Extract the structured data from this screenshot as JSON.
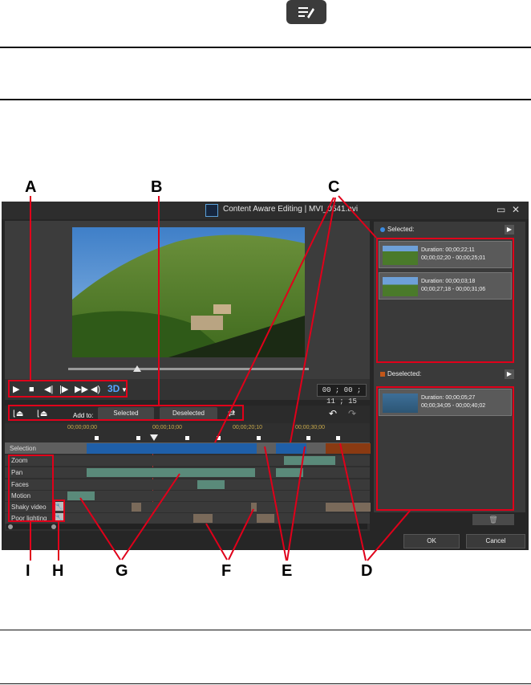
{
  "window": {
    "title": "Content Aware Editing",
    "separator": "|",
    "filename": "MVI_0541.avi",
    "restore_glyph": "▭",
    "close_glyph": "✕"
  },
  "callouts": [
    "A",
    "B",
    "C",
    "D",
    "E",
    "F",
    "G",
    "H",
    "I"
  ],
  "player": {
    "timecode": "00 ; 00 ; 11 ; 15",
    "mode_3d": "3D",
    "buttons": [
      "play-icon",
      "stop-icon",
      "prev-frame-icon",
      "next-frame-icon",
      "fast-forward-icon",
      "volume-icon"
    ]
  },
  "toolbar": {
    "add_to_label": "Add to:",
    "selected_button": "Selected",
    "deselected_button": "Deselected"
  },
  "ruler": [
    "00;00;00;00",
    "00;00;10;00",
    "00;00;20;10",
    "00;00;30;00"
  ],
  "rows": {
    "selection": "Selection",
    "labels": [
      "Zoom",
      "Pan",
      "Faces",
      "Motion",
      "Shaky video",
      "Poor lighting"
    ]
  },
  "selected_panel": {
    "heading": "Selected:",
    "clips": [
      {
        "duration": "Duration: 00;00;22;11",
        "range": "00;00;02;20 - 00;00;25;01"
      },
      {
        "duration": "Duration: 00;00;03;18",
        "range": "00;00;27;18 - 00;00;31;06"
      }
    ]
  },
  "deselected_panel": {
    "heading": "Deselected:",
    "clips": [
      {
        "duration": "Duration: 00;00;05;27",
        "range": "00;00;34;05 - 00;00;40;02"
      }
    ]
  },
  "footer": {
    "ok": "OK",
    "cancel": "Cancel"
  },
  "colors": {
    "selection_blue": "#1f5fa8",
    "deselected_orange": "#8a3a12",
    "feature_green": "#5a8a7a",
    "callout_red": "#e0001a"
  }
}
